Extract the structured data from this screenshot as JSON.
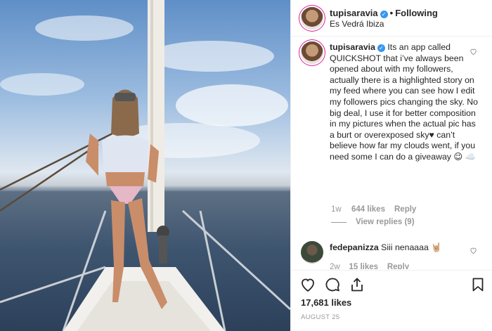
{
  "post": {
    "username": "tupisaravia",
    "follow_status": "Following",
    "location": "Es Vedrá Ibiza"
  },
  "caption": {
    "username": "tupisaravia",
    "text": "Its an app called QUICKSHOT that i’ve always been opened about with my followers, actually there is a highlighted story on my feed where you can see how I edit my followers pics changing the sky. No big deal, I use it for better composition in my pictures when the actual pic has a burt or overexposed sky♥ can’t believe how far my clouds went, if you need some I can do a giveaway 😉 ☁️",
    "age": "1w",
    "likes": "644 likes",
    "reply_label": "Reply",
    "view_replies": "View replies (9)"
  },
  "comment2": {
    "username": "fedepanizza",
    "text": "Siii nenaaaa 🤘🏼",
    "age": "2w",
    "likes": "15 likes",
    "reply_label": "Reply"
  },
  "footer": {
    "likes": "17,681 likes",
    "date": "AUGUST 25"
  },
  "colors": {
    "verified": "#3897f0",
    "story_ring": "#d6249f",
    "muted_text": "#999999"
  }
}
